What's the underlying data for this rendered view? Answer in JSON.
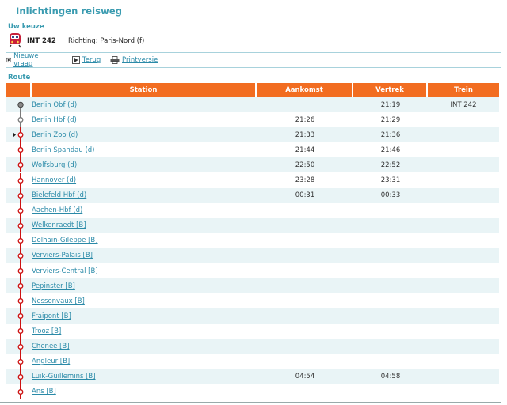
{
  "page": {
    "title": "Inlichtingen reisweg"
  },
  "choice": {
    "label": "Uw keuze",
    "train": "INT 242",
    "direction": "Richting: Paris-Nord (f)"
  },
  "actions": {
    "new_query": "Nieuwe vraag",
    "back": "Terug",
    "print": "Printversie"
  },
  "route": {
    "label": "Route",
    "headers": {
      "station": "Station",
      "arrival": "Aankomst",
      "departure": "Vertrek",
      "train": "Trein"
    },
    "rows": [
      {
        "station": "Berlin Obf (d)",
        "arrival": "",
        "departure": "21:19",
        "train": "INT 242",
        "line_color": "#7a7a7a",
        "dot": "start"
      },
      {
        "station": "Berlin Hbf (d)",
        "arrival": "21:26",
        "departure": "21:29",
        "train": "",
        "line_color": "#7a7a7a",
        "dot": "normal"
      },
      {
        "station": "Berlin Zoo (d)",
        "arrival": "21:33",
        "departure": "21:36",
        "train": "",
        "line_color": "#cc1111",
        "dot": "current"
      },
      {
        "station": "Berlin Spandau (d)",
        "arrival": "21:44",
        "departure": "21:46",
        "train": "",
        "line_color": "#cc1111",
        "dot": "normal"
      },
      {
        "station": "Wolfsburg (d)",
        "arrival": "22:50",
        "departure": "22:52",
        "train": "",
        "line_color": "#cc1111",
        "dot": "normal"
      },
      {
        "station": "Hannover (d)",
        "arrival": "23:28",
        "departure": "23:31",
        "train": "",
        "line_color": "#cc1111",
        "dot": "normal"
      },
      {
        "station": "Bielefeld Hbf (d)",
        "arrival": "00:31",
        "departure": "00:33",
        "train": "",
        "line_color": "#cc1111",
        "dot": "normal"
      },
      {
        "station": "Aachen-Hbf (d)",
        "arrival": "",
        "departure": "",
        "train": "",
        "line_color": "#cc1111",
        "dot": "normal"
      },
      {
        "station": "Welkenraedt [B]",
        "arrival": "",
        "departure": "",
        "train": "",
        "line_color": "#cc1111",
        "dot": "normal"
      },
      {
        "station": "Dolhain-Gileppe [B]",
        "arrival": "",
        "departure": "",
        "train": "",
        "line_color": "#cc1111",
        "dot": "normal"
      },
      {
        "station": "Verviers-Palais [B]",
        "arrival": "",
        "departure": "",
        "train": "",
        "line_color": "#cc1111",
        "dot": "normal"
      },
      {
        "station": "Verviers-Central [B]",
        "arrival": "",
        "departure": "",
        "train": "",
        "line_color": "#cc1111",
        "dot": "normal"
      },
      {
        "station": "Pepinster [B]",
        "arrival": "",
        "departure": "",
        "train": "",
        "line_color": "#cc1111",
        "dot": "normal"
      },
      {
        "station": "Nessonvaux [B]",
        "arrival": "",
        "departure": "",
        "train": "",
        "line_color": "#cc1111",
        "dot": "normal"
      },
      {
        "station": "Fraipont [B]",
        "arrival": "",
        "departure": "",
        "train": "",
        "line_color": "#cc1111",
        "dot": "normal"
      },
      {
        "station": "Trooz [B]",
        "arrival": "",
        "departure": "",
        "train": "",
        "line_color": "#cc1111",
        "dot": "normal"
      },
      {
        "station": "Chenee [B]",
        "arrival": "",
        "departure": "",
        "train": "",
        "line_color": "#cc1111",
        "dot": "normal"
      },
      {
        "station": "Angleur [B]",
        "arrival": "",
        "departure": "",
        "train": "",
        "line_color": "#cc1111",
        "dot": "normal"
      },
      {
        "station": "Luik-Guillemins [B]",
        "arrival": "04:54",
        "departure": "04:58",
        "train": "",
        "line_color": "#cc1111",
        "dot": "normal"
      },
      {
        "station": "Ans [B]",
        "arrival": "",
        "departure": "",
        "train": "",
        "line_color": "#cc1111",
        "dot": "normal"
      }
    ]
  },
  "colors": {
    "accent": "#3a9bb0",
    "header_bg": "#f26d21",
    "link": "#2a8aa8",
    "row_alt": "#e9f4f6"
  }
}
